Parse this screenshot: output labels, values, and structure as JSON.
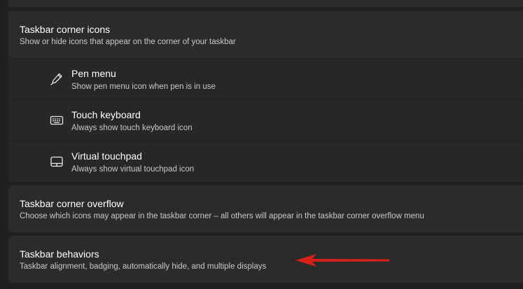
{
  "settings": {
    "corner_icons": {
      "title": "Taskbar corner icons",
      "description": "Show or hide icons that appear on the corner of your taskbar",
      "items": [
        {
          "label": "Pen menu",
          "description": "Show pen menu icon when pen is in use",
          "icon": "pen-icon"
        },
        {
          "label": "Touch keyboard",
          "description": "Always show touch keyboard icon",
          "icon": "keyboard-icon"
        },
        {
          "label": "Virtual touchpad",
          "description": "Always show virtual touchpad icon",
          "icon": "touchpad-icon"
        }
      ]
    },
    "corner_overflow": {
      "title": "Taskbar corner overflow",
      "description": "Choose which icons may appear in the taskbar corner – all others will appear in the taskbar corner overflow menu"
    },
    "behaviors": {
      "title": "Taskbar behaviors",
      "description": "Taskbar alignment, badging, automatically hide, and multiple displays"
    }
  },
  "annotation": {
    "arrow_color": "#d9201a",
    "icon": "red-arrow-icon"
  }
}
